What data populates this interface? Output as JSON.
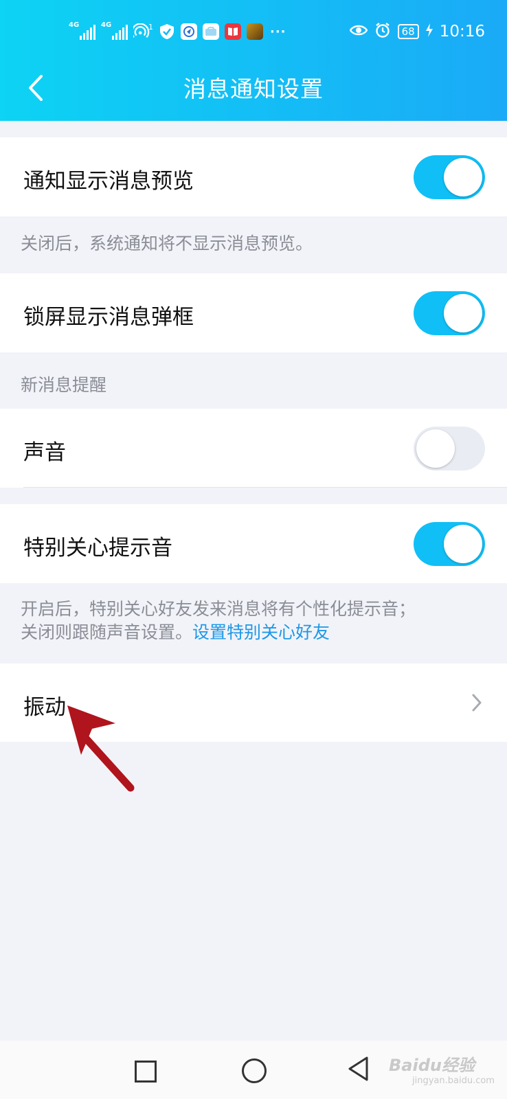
{
  "status_bar": {
    "network_1": "4G",
    "network_2": "4G",
    "hotspot_badge": "1",
    "battery": "68",
    "time": "10:16",
    "more": "···"
  },
  "nav": {
    "title": "消息通知设置"
  },
  "settings": {
    "preview": {
      "label": "通知显示消息预览",
      "enabled": true,
      "note": "关闭后，系统通知将不显示消息预览。"
    },
    "lockscreen": {
      "label": "锁屏显示消息弹框",
      "enabled": true
    },
    "section_new_message": "新消息提醒",
    "sound": {
      "label": "声音",
      "enabled": false
    },
    "special_care": {
      "label": "特别关心提示音",
      "enabled": true,
      "note_line1": "开启后，特别关心好友发来消息将有个性化提示音；",
      "note_line2": "关闭则跟随声音设置。",
      "note_link": "设置特别关心好友"
    },
    "vibrate": {
      "label": "振动"
    }
  },
  "watermark": {
    "text": "Baidu经验",
    "sub": "jingyan.baidu.com"
  },
  "colors": {
    "accent": "#10bff6",
    "link": "#1c97e8",
    "annotation_arrow": "#b0141c"
  }
}
